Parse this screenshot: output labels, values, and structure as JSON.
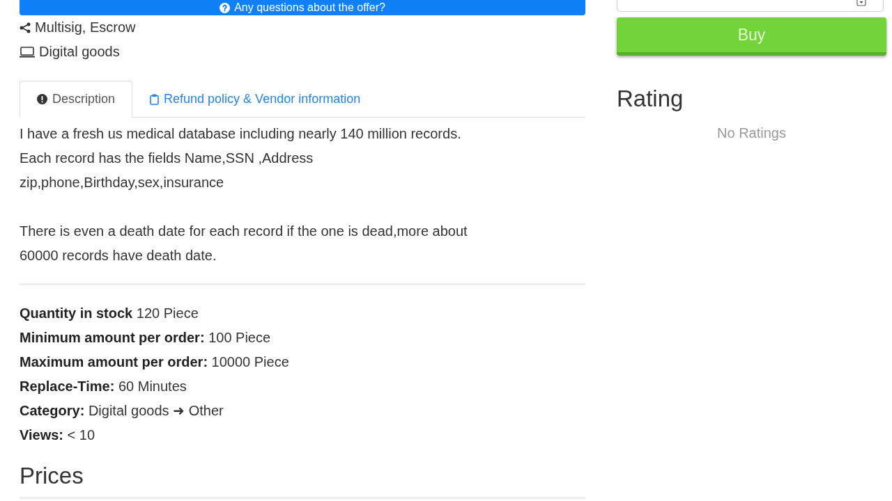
{
  "offer_button": {
    "label": "Any questions about the offer?"
  },
  "features": [
    {
      "kind": "payment",
      "text": "Multisig, Escrow"
    },
    {
      "kind": "type",
      "text": "Digital goods"
    }
  ],
  "tabs": [
    {
      "kind": "description",
      "label": "Description",
      "selected": true
    },
    {
      "kind": "policy",
      "label": "Refund policy & Vendor information",
      "selected": false
    }
  ],
  "description": {
    "paragraphs": [
      "I have a fresh us medical database including nearly 140 million records.\nEach record has the fields Name,SSN ,Address\nzip,phone,Birthday,sex,insurance",
      "There is even a death date for each record if the one is dead,more about\n60000 records have death date."
    ]
  },
  "details": [
    "**Quantity in stock** 120 Piece",
    "**Minimum amount per order:** 100 Piece",
    "**Maximum amount per order:** 10000 Piece",
    "**Replace-Time:** 60 Minutes",
    "**Category:** Digital goods ➜ Other",
    "**Views:** < 10"
  ],
  "prices": {
    "title": "Prices"
  },
  "order": {
    "buy_button": {
      "label": "Buy"
    }
  },
  "rating": {
    "title": "Rating",
    "empty_text": "No Ratings"
  }
}
